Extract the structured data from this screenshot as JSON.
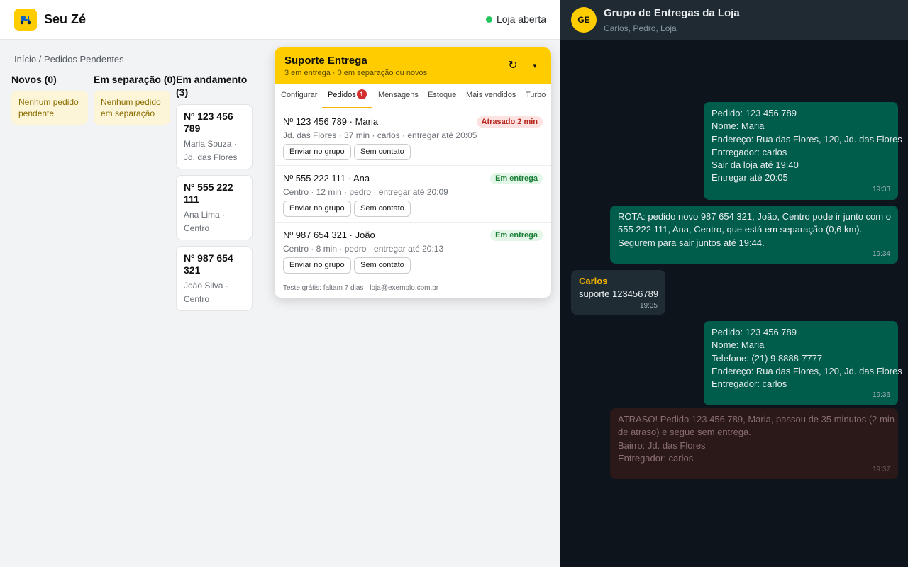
{
  "app": {
    "brand": "Seu Zé",
    "store_status": "Loja aberta",
    "breadcrumb": "Início / Pedidos Pendentes"
  },
  "board": {
    "columns": [
      {
        "title": "Novos (0)",
        "empty_text": "Nenhum pedido pendente"
      },
      {
        "title": "Em separação (0)",
        "empty_text": "Nenhum pedido em separação"
      },
      {
        "title": "Em andamento (3)"
      }
    ],
    "cards": [
      {
        "number": "Nº 123 456 789",
        "details": "Maria Souza · Jd. das Flores"
      },
      {
        "number": "Nº 555 222 111",
        "details": "Ana Lima · Centro"
      },
      {
        "number": "Nº 987 654 321",
        "details": "João Silva · Centro"
      }
    ]
  },
  "panel": {
    "title": "Suporte Entrega",
    "subtitle": "3 em entrega · 0 em separação ou novos",
    "refresh_icon": "↻",
    "collapse_icon": "▾",
    "tabs": [
      "Configurar",
      "Pedidos",
      "Mensagens",
      "Estoque",
      "Mais vendidos",
      "Turbo"
    ],
    "active_tab": "Pedidos",
    "tab_badge": "1",
    "orders": [
      {
        "title": "Nº 123 456 789 · Maria",
        "meta": "Jd. das Flores · 37 min · carlos · entregar até 20:05",
        "badge": "Atrasado 2 min",
        "badge_type": "late",
        "btn_group": "Enviar no grupo",
        "btn_contact": "Sem contato"
      },
      {
        "title": "Nº 555 222 111 · Ana",
        "meta": "Centro · 12 min · pedro · entregar até 20:09",
        "badge": "Em entrega",
        "badge_type": "ok",
        "btn_group": "Enviar no grupo",
        "btn_contact": "Sem contato"
      },
      {
        "title": "Nº 987 654 321 · João",
        "meta": "Centro · 8 min · pedro · entregar até 20:13",
        "badge": "Em entrega",
        "badge_type": "ok",
        "btn_group": "Enviar no grupo",
        "btn_contact": "Sem contato"
      }
    ],
    "footer": "Teste grátis: faltam 7 dias · loja@exemplo.com.br"
  },
  "chat": {
    "avatar": "GE",
    "title": "Grupo de Entregas da Loja",
    "members": "Carlos, Pedro, Loja",
    "messages": [
      {
        "lines": [
          "Pedido: 123 456 789",
          "Nome: Maria",
          "Endereço: Rua das Flores, 120, Jd. das Flores",
          "Entregador: carlos",
          "Sair da loja até 19:40",
          "Entregar até 20:05"
        ],
        "time": "19:33"
      },
      {
        "lines": [
          "ROTA: pedido novo 987 654 321, João, Centro pode ir junto com o",
          "555 222 111, Ana, Centro, que está em separação (0,6 km).",
          "Segurem para sair juntos até 19:44."
        ],
        "time": "19:34"
      },
      {
        "author": "Carlos",
        "lines": [
          "suporte 123456789"
        ],
        "time": "19:35"
      },
      {
        "lines": [
          "Pedido: 123 456 789",
          "Nome: Maria",
          "Telefone: (21) 9 8888-7777",
          "Endereço: Rua das Flores, 120, Jd. das Flores",
          "Entregador: carlos"
        ],
        "time": "19:36"
      },
      {
        "lines": [
          "ATRASO! Pedido 123 456 789, Maria, passou de 35 minutos (2 min",
          "de atraso) e segue sem entrega.",
          "Bairro: Jd. das Flores",
          "Entregador: carlos"
        ],
        "time": "19:37"
      }
    ]
  },
  "colors": {
    "brand_yellow": "#ffcc00",
    "status_green": "#22c55e",
    "outgoing_bubble": "#005c4b",
    "incoming_bubble": "#202c33",
    "warning_bubble": "#2b1919"
  }
}
